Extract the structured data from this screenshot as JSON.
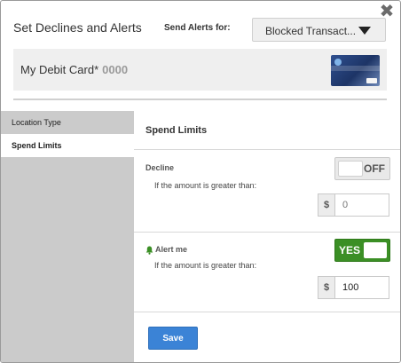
{
  "header": {
    "title": "Set Declines and Alerts",
    "send_label": "Send Alerts for:",
    "dropdown_value": "Blocked Transact...",
    "close_glyph": "✖"
  },
  "card": {
    "name": "My Debit Card*",
    "number": "0000",
    "image_icon": "debit-card-image"
  },
  "sidebar": {
    "items": [
      {
        "label": "Location Type",
        "active": false
      },
      {
        "label": "Spend Limits",
        "active": true
      }
    ]
  },
  "main": {
    "section_title": "Spend Limits",
    "decline": {
      "label": "Decline",
      "sub": "If the amount is greater than:",
      "toggle_text": "OFF",
      "currency": "$",
      "placeholder": "0"
    },
    "alert": {
      "label": "Alert me",
      "icon": "bell-icon",
      "sub": "If the amount is greater than:",
      "toggle_text": "YES",
      "currency": "$",
      "value": "100"
    },
    "save_label": "Save"
  },
  "colors": {
    "toggle_on": "#3b8f25",
    "save_button": "#3b83d6",
    "sidebar_bg": "#cbcbcb"
  }
}
